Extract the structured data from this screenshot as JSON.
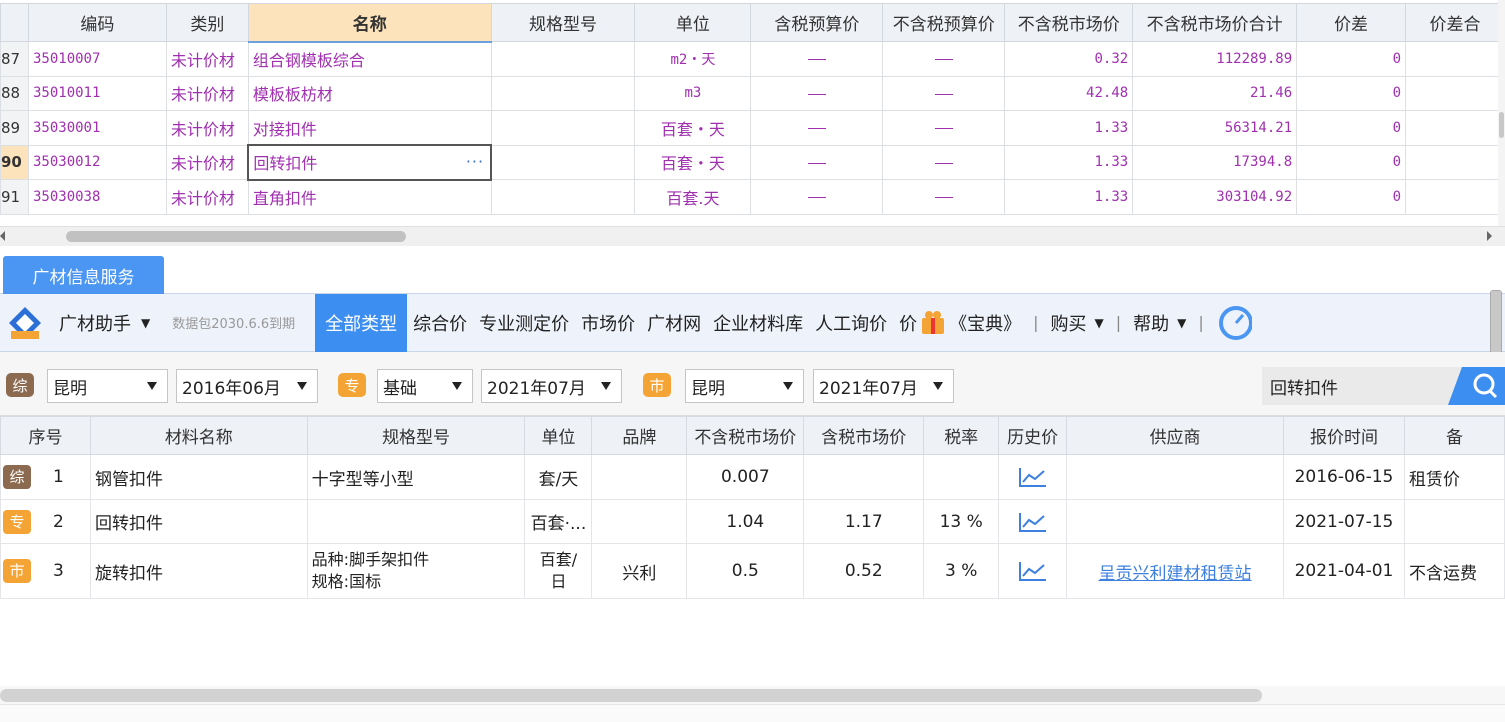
{
  "top_grid": {
    "columns": [
      "",
      "编码",
      "类别",
      "名称",
      "规格型号",
      "单位",
      "含税预算价",
      "不含税预算价",
      "不含税市场价",
      "不含税市场价合计",
      "价差",
      "价差合"
    ],
    "rows": [
      {
        "num": "87",
        "code": "35010007",
        "category": "未计价材",
        "name": "组合钢模板综合",
        "spec": "",
        "unit": "m2・天",
        "price_budget_tax": "—",
        "price_budget_notax": "—",
        "market_notax": "0.32",
        "market_total": "112289.89",
        "diff": "0"
      },
      {
        "num": "88",
        "code": "35010011",
        "category": "未计价材",
        "name": "模板板枋材",
        "spec": "",
        "unit": "m3",
        "price_budget_tax": "—",
        "price_budget_notax": "—",
        "market_notax": "42.48",
        "market_total": "21.46",
        "diff": "0"
      },
      {
        "num": "89",
        "code": "35030001",
        "category": "未计价材",
        "name": "对接扣件",
        "spec": "",
        "unit": "百套・天",
        "price_budget_tax": "—",
        "price_budget_notax": "—",
        "market_notax": "1.33",
        "market_total": "56314.21",
        "diff": "0"
      },
      {
        "num": "90",
        "code": "35030012",
        "category": "未计价材",
        "name": "回转扣件",
        "spec": "",
        "unit": "百套・天",
        "price_budget_tax": "—",
        "price_budget_notax": "—",
        "market_notax": "1.33",
        "market_total": "17394.8",
        "diff": "0"
      },
      {
        "num": "91",
        "code": "35030038",
        "category": "未计价材",
        "name": "直角扣件",
        "spec": "",
        "unit": "百套.天",
        "price_budget_tax": "—",
        "price_budget_notax": "—",
        "market_notax": "1.33",
        "market_total": "303104.92",
        "diff": "0"
      }
    ],
    "editing_dots": "···"
  },
  "panel": {
    "tab_label": "广材信息服务",
    "brand": "广材助手",
    "expire_text": "数据包2030.6.6到期",
    "nav": [
      "全部类型",
      "综合价",
      "专业测定价",
      "市场价",
      "广材网",
      "企业材料库",
      "人工询价",
      "价"
    ],
    "book_text": "《宝典》",
    "buy_label": "购买",
    "help_label": "帮助",
    "sep": "|"
  },
  "filters": {
    "badge_zong": "综",
    "badge_zhuan": "专",
    "badge_shi": "市",
    "zong_city": "昆明",
    "zong_date": "2016年06月",
    "zhuan_type": "基础",
    "zhuan_date": "2021年07月",
    "shi_city": "昆明",
    "shi_date": "2021年07月",
    "search_value": "回转扣件"
  },
  "results": {
    "columns": [
      "序号",
      "材料名称",
      "规格型号",
      "单位",
      "品牌",
      "不含税市场价",
      "含税市场价",
      "税率",
      "历史价",
      "供应商",
      "报价时间",
      "备"
    ],
    "rows": [
      {
        "badge": "综",
        "seq": "1",
        "name": "钢管扣件",
        "spec": "十字型等小型",
        "unit": "套/天",
        "brand": "",
        "price_notax": "0.007",
        "price_tax": "",
        "tax_rate": "",
        "supplier": "",
        "date": "2016-06-15",
        "note": "租赁价"
      },
      {
        "badge": "专",
        "seq": "2",
        "name": "回转扣件",
        "spec": "",
        "unit": "百套·...",
        "brand": "",
        "price_notax": "1.04",
        "price_tax": "1.17",
        "tax_rate": "13 %",
        "supplier": "",
        "date": "2021-07-15",
        "note": ""
      },
      {
        "badge": "市",
        "seq": "3",
        "name": "旋转扣件",
        "spec": "品种:脚手架扣件\n规格:国标",
        "unit": "百套/\n日",
        "brand": "兴利",
        "price_notax": "0.5",
        "price_tax": "0.52",
        "tax_rate": "3 %",
        "supplier": "呈贡兴利建材租赁站",
        "date": "2021-04-01",
        "note": "不含运费"
      }
    ]
  },
  "colors": {
    "accent": "#3d8ef1",
    "purple_text": "#a030b0",
    "active_header": "#fde3bb",
    "badge_brown": "#8b6a50",
    "badge_orange": "#f4a335"
  }
}
